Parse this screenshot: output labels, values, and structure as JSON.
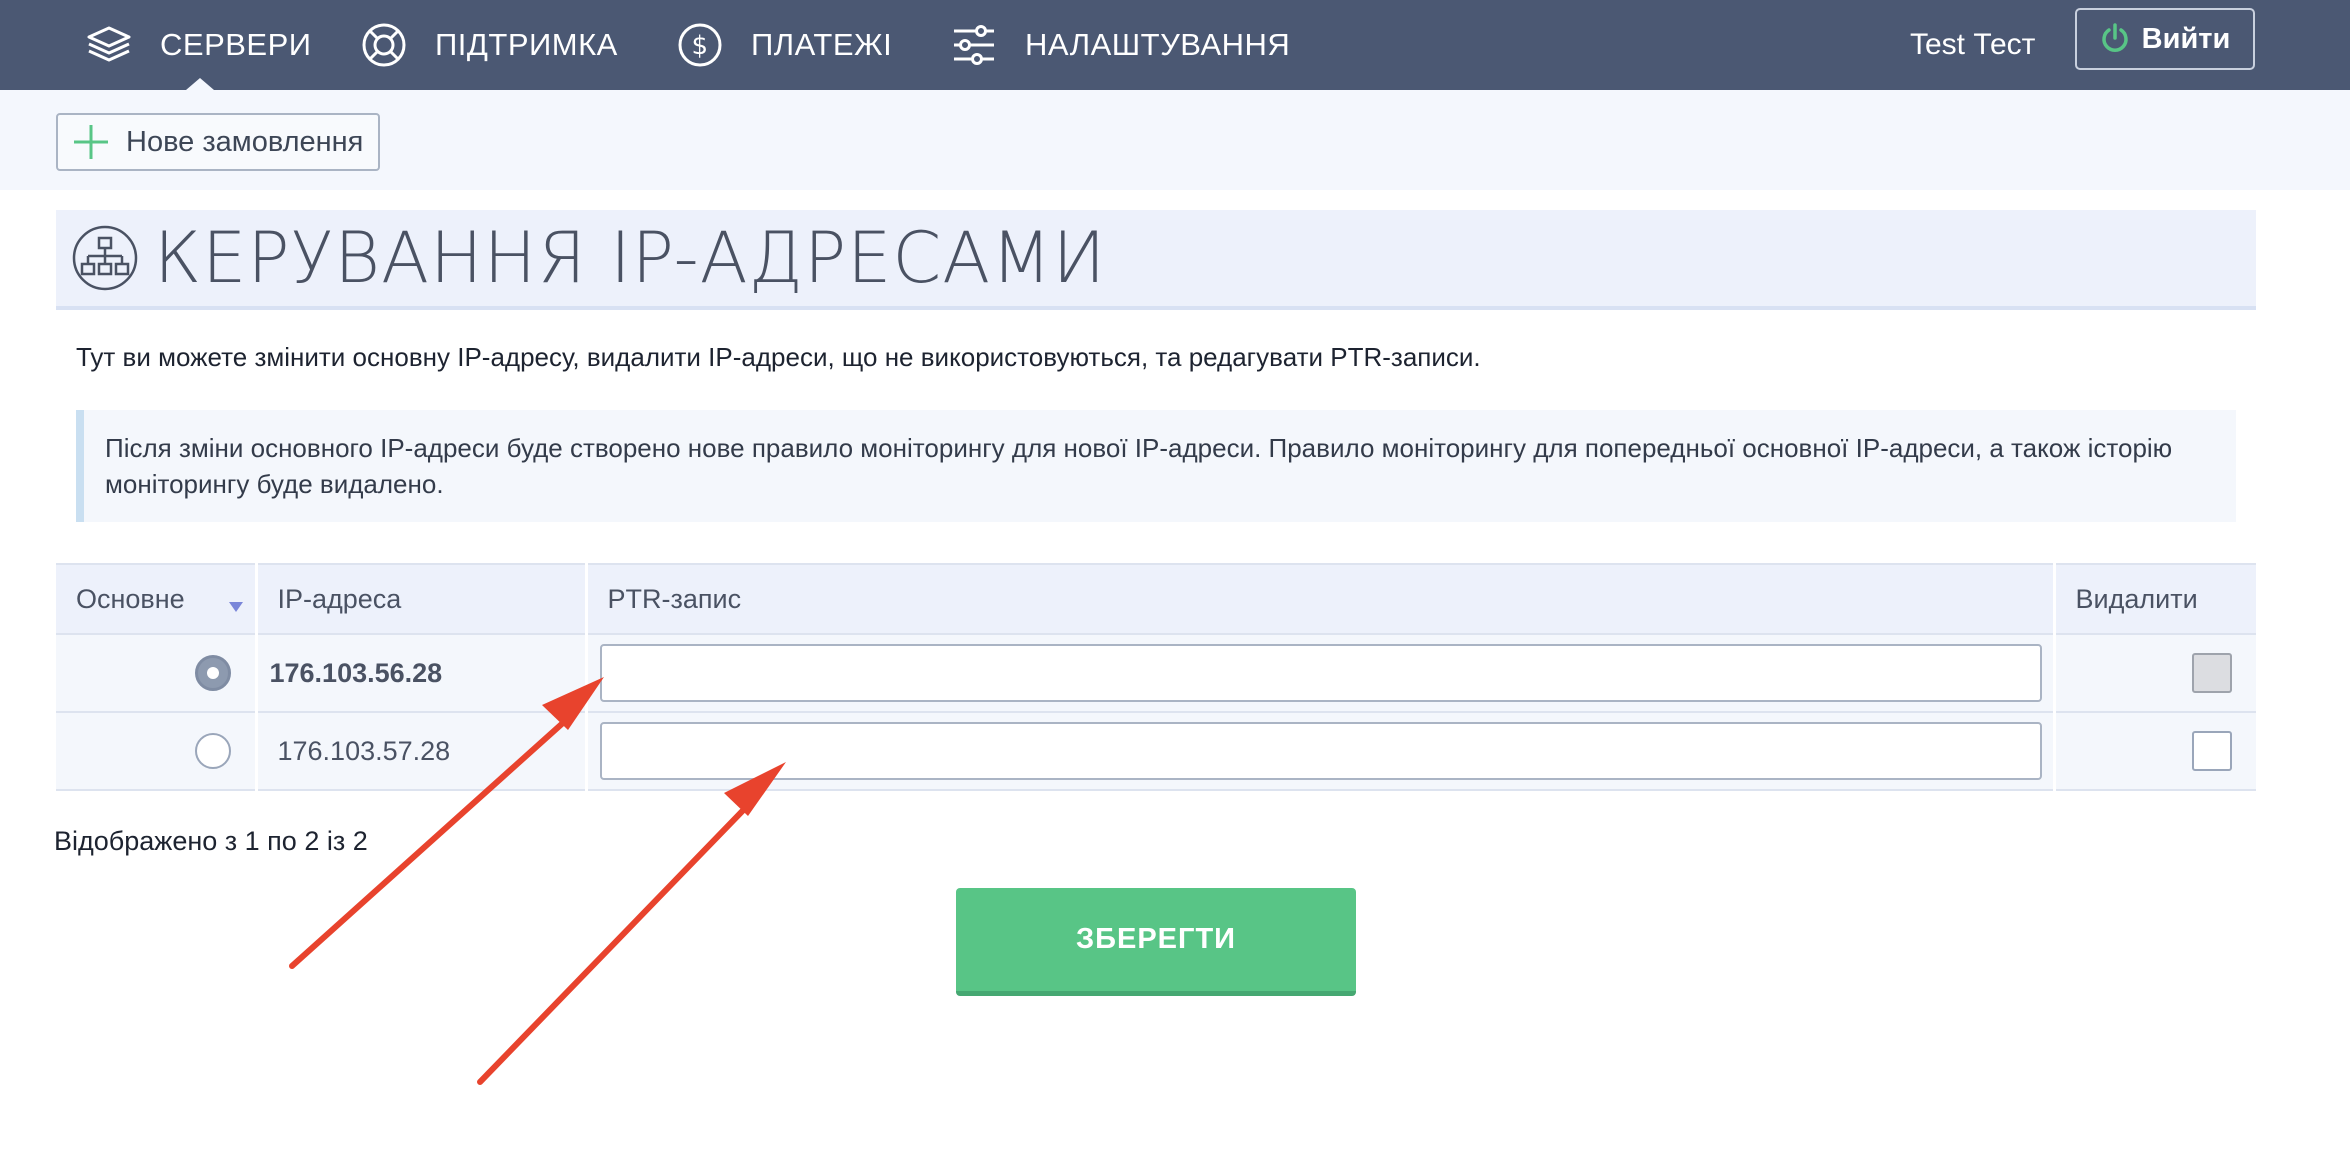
{
  "nav": {
    "items": [
      {
        "label": "СЕРВЕРИ",
        "icon": "layers-icon"
      },
      {
        "label": "ПІДТРИМКА",
        "icon": "lifebuoy-icon"
      },
      {
        "label": "ПЛАТЕЖІ",
        "icon": "dollar-icon"
      },
      {
        "label": "НАЛАШТУВАННЯ",
        "icon": "sliders-icon"
      }
    ],
    "username": "Test Тест",
    "logout_label": "Вийти"
  },
  "toolbar": {
    "new_order_label": "Нове замовлення"
  },
  "page": {
    "title": "КЕРУВАННЯ IP-АДРЕСАМИ",
    "intro": "Тут ви можете змінити основну IP-адресу, видалити IP-адреси, що не використовуються, та редагувати PTR-записи.",
    "notice": "Після зміни основного IP-адреси буде створено нове правило моніторингу для нової IP-адреси. Правило моніторингу для попередньої основної IP-адреси, а також історію моніторингу буде видалено."
  },
  "table": {
    "headers": {
      "primary": "Основне",
      "ip": "IP-адреса",
      "ptr": "PTR-запис",
      "delete": "Видалити"
    },
    "rows": [
      {
        "ip": "176.103.56.28",
        "ptr": "",
        "primary": true,
        "delete_disabled": true
      },
      {
        "ip": "176.103.57.28",
        "ptr": "",
        "primary": false,
        "delete_disabled": false
      }
    ],
    "shown_text": "Відображено з 1 по 2 із 2"
  },
  "actions": {
    "save_label": "ЗБЕРЕГТИ"
  },
  "colors": {
    "nav_bg": "#4b5873",
    "save_green": "#58c586",
    "arrow_red": "#e8432d"
  }
}
